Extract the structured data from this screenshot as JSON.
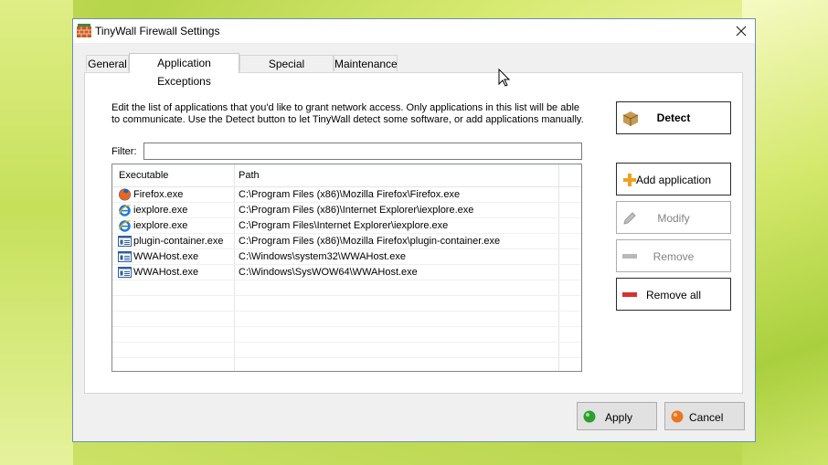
{
  "window": {
    "title": "TinyWall Firewall Settings"
  },
  "tabs": [
    {
      "label": "General"
    },
    {
      "label": "Application Exceptions"
    },
    {
      "label": "Special Exceptions"
    },
    {
      "label": "Maintenance"
    }
  ],
  "panel": {
    "description": "Edit the list of applications that you'd like to grant network access. Only applications in this list will be able to communicate. Use the Detect button to let TinyWall detect some software, or add applications manually.",
    "filter_label": "Filter:",
    "filter_value": "",
    "columns": {
      "executable": "Executable",
      "path": "Path"
    },
    "rows": [
      {
        "icon": "firefox-icon",
        "executable": "Firefox.exe",
        "path": "C:\\Program Files (x86)\\Mozilla Firefox\\Firefox.exe"
      },
      {
        "icon": "internet-explorer-icon",
        "executable": "iexplore.exe",
        "path": "C:\\Program Files (x86)\\Internet Explorer\\iexplore.exe"
      },
      {
        "icon": "internet-explorer-icon",
        "executable": "iexplore.exe",
        "path": "C:\\Program Files\\Internet Explorer\\iexplore.exe"
      },
      {
        "icon": "window-app-icon",
        "executable": "plugin-container.exe",
        "path": "C:\\Program Files (x86)\\Mozilla Firefox\\plugin-container.exe"
      },
      {
        "icon": "window-app-icon",
        "executable": "WWAHost.exe",
        "path": "C:\\Windows\\system32\\WWAHost.exe"
      },
      {
        "icon": "window-app-icon",
        "executable": "WWAHost.exe",
        "path": "C:\\Windows\\SysWOW64\\WWAHost.exe"
      }
    ]
  },
  "side_buttons": {
    "detect": "Detect",
    "add": "Add application",
    "modify": "Modify",
    "remove": "Remove",
    "remove_all": "Remove all"
  },
  "bottom_buttons": {
    "apply": "Apply",
    "cancel": "Cancel"
  },
  "colors": {
    "accent": "#0078d7",
    "apply_green": "#2e9e2e",
    "cancel_orange": "#e87722",
    "remove_red": "#d8322a"
  }
}
